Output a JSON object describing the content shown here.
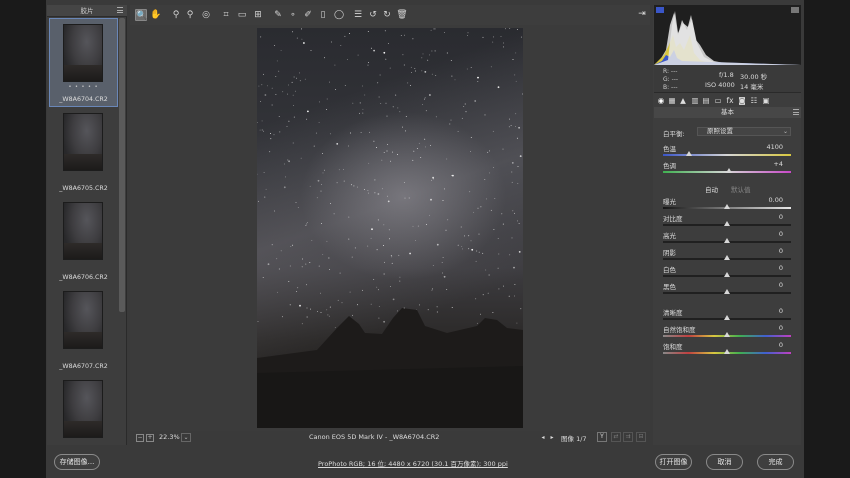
{
  "filmstrip": {
    "title": "胶片",
    "items": [
      {
        "name": "_W8A6704.CR2",
        "stars": "• • • • •",
        "selected": true
      },
      {
        "name": "_W8A6705.CR2",
        "stars": "",
        "selected": false
      },
      {
        "name": "_W8A6706.CR2",
        "stars": "",
        "selected": false
      },
      {
        "name": "_W8A6707.CR2",
        "stars": "",
        "selected": false
      },
      {
        "name": "",
        "stars": "",
        "selected": false
      }
    ]
  },
  "toolbar": {
    "tools": [
      {
        "name": "zoom-icon",
        "glyph": "🔍",
        "active": true
      },
      {
        "name": "hand-icon",
        "glyph": "✋",
        "active": false
      },
      {
        "name": "white-balance-icon",
        "glyph": "⚲",
        "active": false
      },
      {
        "name": "color-sampler-icon",
        "glyph": "⚲",
        "active": false
      },
      {
        "name": "target-adjust-icon",
        "glyph": "◎",
        "active": false
      },
      {
        "name": "crop-icon",
        "glyph": "⌗",
        "active": false
      },
      {
        "name": "straighten-icon",
        "glyph": "▭",
        "active": false
      },
      {
        "name": "transform-icon",
        "glyph": "⊞",
        "active": false
      },
      {
        "name": "spot-removal-icon",
        "glyph": "✎",
        "active": false
      },
      {
        "name": "red-eye-icon",
        "glyph": "∘",
        "active": false
      },
      {
        "name": "adjustment-brush-icon",
        "glyph": "✐",
        "active": false
      },
      {
        "name": "graduated-filter-icon",
        "glyph": "▯",
        "active": false
      },
      {
        "name": "radial-filter-icon",
        "glyph": "◯",
        "active": false
      },
      {
        "name": "preferences-icon",
        "glyph": "☰",
        "active": false
      },
      {
        "name": "rotate-left-icon",
        "glyph": "↺",
        "active": false
      },
      {
        "name": "rotate-right-icon",
        "glyph": "↻",
        "active": false
      },
      {
        "name": "trash-icon",
        "glyph": "🗑",
        "active": false
      }
    ]
  },
  "status": {
    "zoom": "22.3%",
    "file_label": "Canon EOS 5D Mark IV  -  _W8A6704.CR2",
    "image_count": "图像 1/7"
  },
  "histogram": {
    "rgb_r": "R:   ---",
    "rgb_g": "G:   ---",
    "rgb_b": "B:   ---",
    "aperture": "f/1.8",
    "shutter": "30.00 秒",
    "iso": "ISO 4000",
    "focal": "14 毫米"
  },
  "panel": {
    "title": "基本",
    "wb_label": "白平衡:",
    "wb_value": "原照设置",
    "temp_label": "色温",
    "temp_value": "4100",
    "tint_label": "色调",
    "tint_value": "+4",
    "auto": "自动",
    "default": "默认值",
    "sliders_group1": [
      {
        "label": "曝光",
        "value": "0.00"
      },
      {
        "label": "对比度",
        "value": "0"
      },
      {
        "label": "高光",
        "value": "0"
      },
      {
        "label": "阴影",
        "value": "0"
      },
      {
        "label": "白色",
        "value": "0"
      },
      {
        "label": "黑色",
        "value": "0"
      }
    ],
    "sliders_group2": [
      {
        "label": "清晰度",
        "value": "0"
      },
      {
        "label": "自然饱和度",
        "value": "0"
      },
      {
        "label": "饱和度",
        "value": "0"
      }
    ]
  },
  "bottom": {
    "save": "存储图像...",
    "workflow": "ProPhoto RGB; 16 位; 4480 x 6720 (30.1 百万像素); 300 ppi",
    "open": "打开图像",
    "cancel": "取消",
    "done": "完成"
  }
}
